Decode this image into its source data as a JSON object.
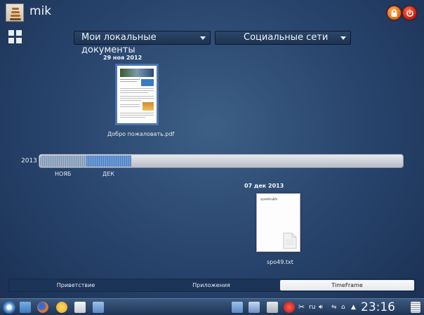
{
  "user": {
    "name": "mik"
  },
  "header": {
    "lock_label": "lock",
    "power_label": "power"
  },
  "dropdowns": {
    "local_docs": "Мои локальные документы",
    "social": "Социальные сети"
  },
  "timeline": {
    "year": "2013",
    "months": [
      "НОЯБ",
      "ДЕК"
    ]
  },
  "documents": [
    {
      "date": "29 ноя 2012",
      "name": "Добро пожаловать.pdf"
    },
    {
      "date": "07 дек 2013",
      "name": "spo49.txt",
      "preview": "zynetitrubfn"
    }
  ],
  "tabs": [
    {
      "label": "Приветствие",
      "active": false
    },
    {
      "label": "Приложения",
      "active": false
    },
    {
      "label": "TimeFrame",
      "active": true
    }
  ],
  "tray": {
    "lang": "ru",
    "clock": "23:16"
  },
  "colors": {
    "accent": "#4f7fc0",
    "background": "#2a4770",
    "power": "#c81a0a"
  }
}
